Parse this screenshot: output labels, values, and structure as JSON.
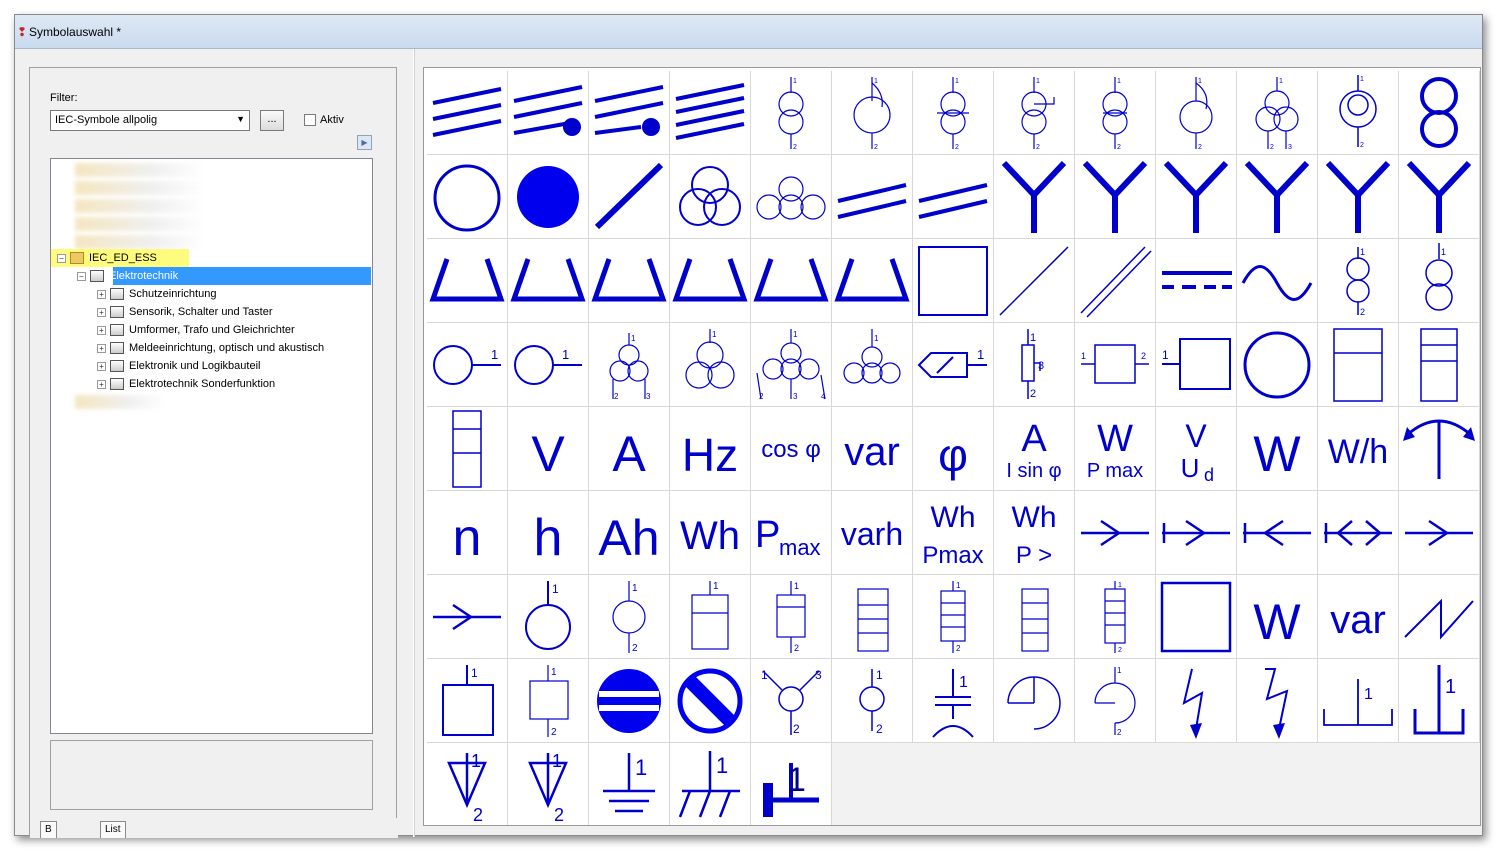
{
  "window": {
    "title": "Symbolauswahl *"
  },
  "filter": {
    "label": "Filter:",
    "value": "IEC-Symbole allpolig",
    "ellipsis": "...",
    "aktiv_label": "Aktiv"
  },
  "tree": {
    "root": "IEC_ED_ESS",
    "selected": "Elektrotechnik",
    "children": [
      "Schutzeinrichtung",
      "Sensorik, Schalter und Taster",
      "Umformer, Trafo und Gleichrichter",
      "Meldeeinrichtung, optisch und akustisch",
      "Elektronik und Logikbauteil",
      "Elektrotechnik Sonderfunktion"
    ]
  },
  "bottom_tabs": [
    "B",
    "List"
  ],
  "symbol_color": "#0000cc",
  "symbols": {
    "r5": [
      "V",
      "A",
      "Hz",
      "cos φ",
      "var",
      "φ",
      "A",
      "I sin φ",
      "W",
      "P max",
      "V",
      "U",
      "d",
      "W",
      "W/h"
    ],
    "r6": [
      "n",
      "h",
      "Ah",
      "Wh",
      "P",
      "max",
      "varh",
      "Wh",
      "Pmax",
      "Wh",
      "P >"
    ],
    "r7": [
      "W",
      "var"
    ],
    "terminal_labels": [
      "1",
      "2",
      "3",
      "4"
    ]
  }
}
